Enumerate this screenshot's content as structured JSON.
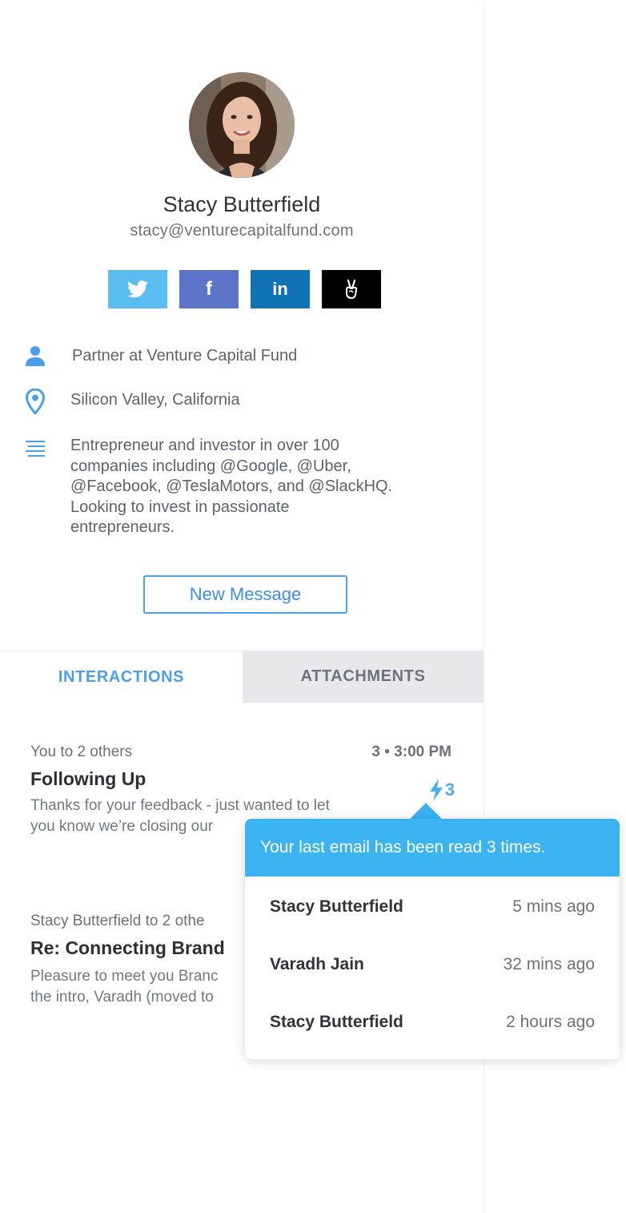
{
  "profile": {
    "name": "Stacy Butterfield",
    "email": "stacy@venturecapitalfund.com"
  },
  "socials": [
    {
      "name": "twitter",
      "icon": "twitter-bird-icon",
      "color": "#5bbcf0"
    },
    {
      "name": "facebook",
      "icon": "facebook-f-icon",
      "color": "#5b74c7",
      "glyph": "f"
    },
    {
      "name": "linkedin",
      "icon": "linkedin-in-icon",
      "color": "#1173b4",
      "glyph": "in"
    },
    {
      "name": "angellist",
      "icon": "angellist-hand-icon",
      "color": "#000000"
    }
  ],
  "info": {
    "title": "Partner at Venture Capital Fund",
    "location": "Silicon Valley, California",
    "bio_lines": [
      "Entrepreneur and investor in over 100",
      "companies including @Google, @Uber,",
      "@Facebook, @TeslaMotors, and @SlackHQ.",
      "Looking to invest in passionate",
      "entrepreneurs."
    ]
  },
  "actions": {
    "new_message": "New Message"
  },
  "tabs": {
    "interactions": "INTERACTIONS",
    "attachments": "ATTACHMENTS"
  },
  "threads": [
    {
      "participants": "You to 2 others",
      "count_time": "3  •  3:00 PM",
      "subject": "Following Up",
      "snippet_lines": [
        "Thanks for your feedback - just wanted to let",
        "you know we’re closing our"
      ],
      "reads": "3"
    },
    {
      "participants": "Stacy Butterfield to 2 othe",
      "subject": "Re: Connecting Brand",
      "snippet_lines": [
        "Pleasure to meet you Branc",
        "the intro, Varadh (moved to"
      ]
    }
  ],
  "popover": {
    "header": "Your last email has been read 3 times.",
    "rows": [
      {
        "name": "Stacy Butterfield",
        "when": "5 mins ago"
      },
      {
        "name": "Varadh Jain",
        "when": "32 mins ago"
      },
      {
        "name": "Stacy Butterfield",
        "when": "2 hours ago"
      }
    ]
  },
  "colors": {
    "accent": "#4a9fe8",
    "popover_header": "#3cb3f1"
  }
}
